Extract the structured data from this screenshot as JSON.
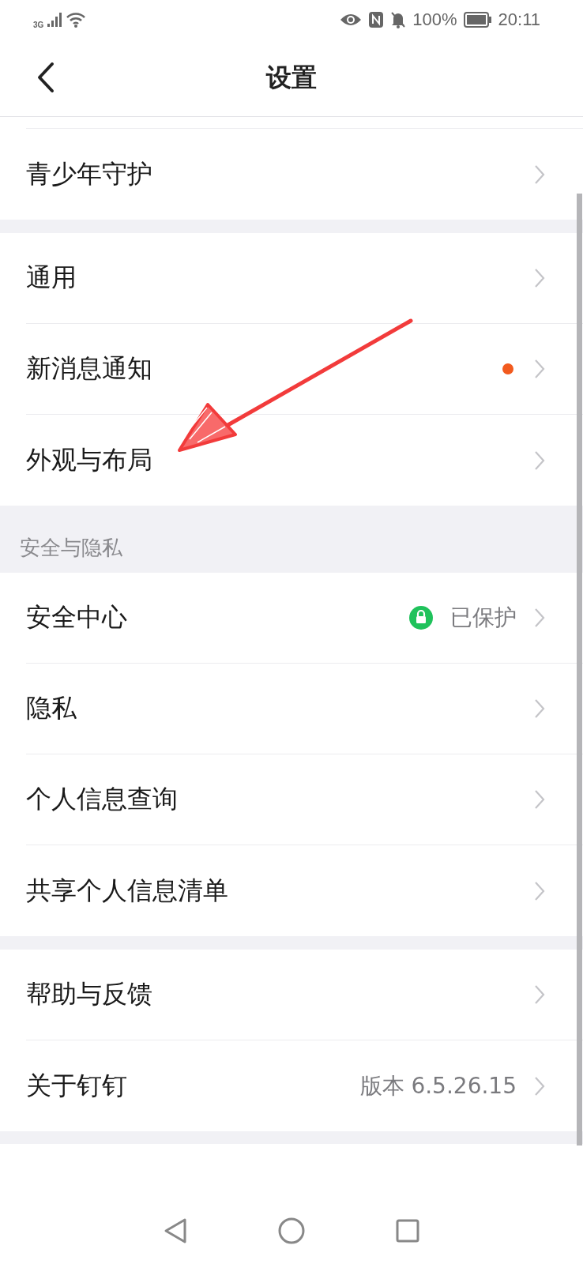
{
  "status_bar": {
    "network": "3G",
    "battery": "100%",
    "time": "20:11"
  },
  "header": {
    "title": "设置"
  },
  "groups": [
    {
      "items": [
        {
          "label": "青少年守护",
          "kind": "plain"
        }
      ]
    },
    {
      "items": [
        {
          "label": "通用",
          "kind": "plain"
        },
        {
          "label": "新消息通知",
          "kind": "dot",
          "color": "#f25a1e"
        },
        {
          "label": "外观与布局",
          "kind": "plain"
        }
      ]
    },
    {
      "section": "安全与隐私",
      "items": [
        {
          "label": "安全中心",
          "kind": "status",
          "value": "已保护"
        },
        {
          "label": "隐私",
          "kind": "plain"
        },
        {
          "label": "个人信息查询",
          "kind": "plain"
        },
        {
          "label": "共享个人信息清单",
          "kind": "plain"
        }
      ]
    },
    {
      "items": [
        {
          "label": "帮助与反馈",
          "kind": "plain"
        },
        {
          "label": "关于钉钉",
          "kind": "value",
          "value": "版本 6.5.26.15"
        }
      ]
    }
  ]
}
